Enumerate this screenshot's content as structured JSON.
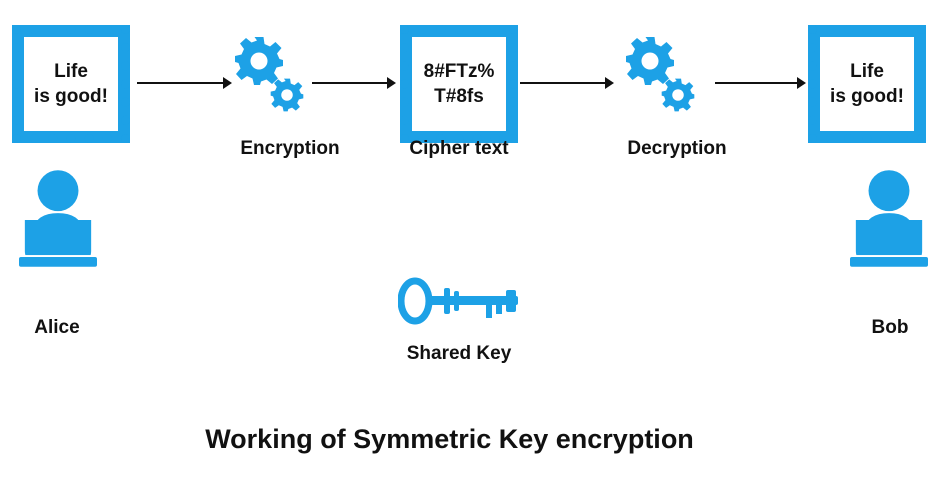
{
  "colors": {
    "accent": "#1da1e6",
    "text": "#111111"
  },
  "diagram": {
    "sender": {
      "message_line1": "Life",
      "message_line2": "is good!",
      "name": "Alice",
      "icon": "person-at-laptop-icon"
    },
    "encryption": {
      "label": "Encryption",
      "icon": "gears-icon"
    },
    "cipher": {
      "line1": "8#FTz%",
      "line2": "T#8fs",
      "label": "Cipher text"
    },
    "decryption": {
      "label": "Decryption",
      "icon": "gears-icon"
    },
    "receiver": {
      "message_line1": "Life",
      "message_line2": "is good!",
      "name": "Bob",
      "icon": "person-at-laptop-icon"
    },
    "shared_key": {
      "label": "Shared Key",
      "icon": "key-icon"
    },
    "title": "Working of Symmetric Key encryption"
  }
}
